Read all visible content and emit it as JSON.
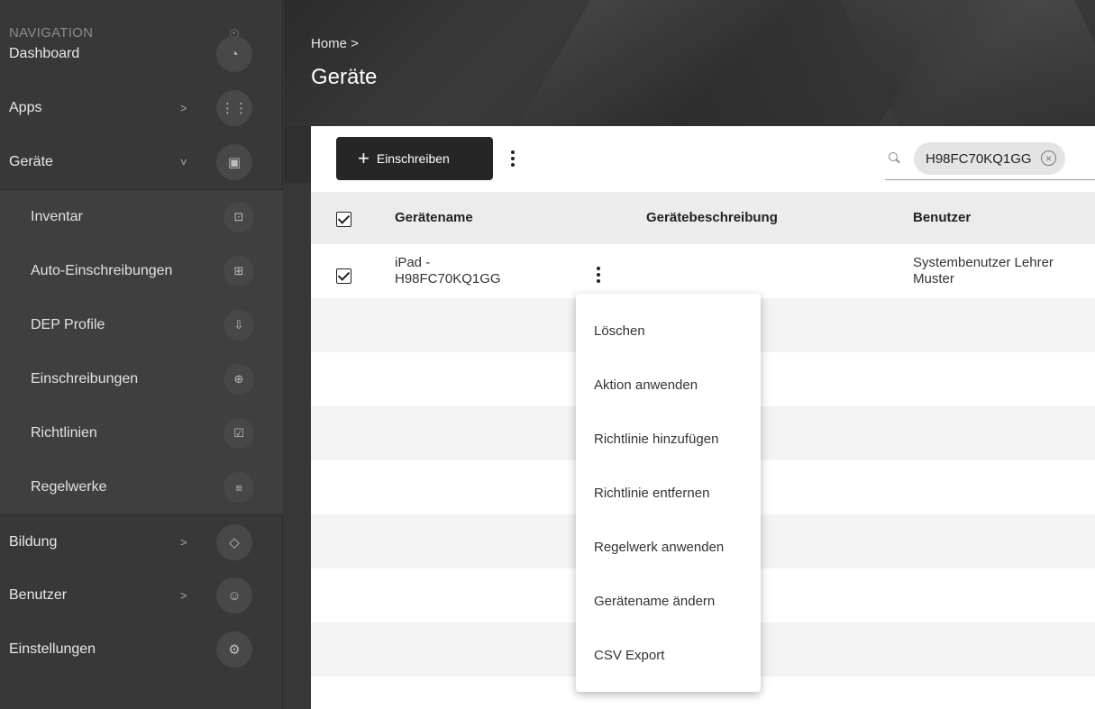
{
  "sidebar": {
    "header": "NAVIGATION",
    "items": [
      {
        "label": "Dashboard",
        "icon": "gauge-icon"
      },
      {
        "label": "Apps",
        "icon": "grid-icon",
        "chevron": ">"
      },
      {
        "label": "Geräte",
        "icon": "devices-icon",
        "chevron": "˅"
      }
    ],
    "subitems": [
      {
        "label": "Inventar",
        "icon": "inventory-icon"
      },
      {
        "label": "Auto-Einschreibungen",
        "icon": "auto-enroll-icon"
      },
      {
        "label": "DEP Profile",
        "icon": "dep-profile-icon"
      },
      {
        "label": "Einschreibungen",
        "icon": "enrollment-icon"
      },
      {
        "label": "Richtlinien",
        "icon": "policy-icon"
      },
      {
        "label": "Regelwerke",
        "icon": "ruleset-icon"
      }
    ],
    "bottom_items": [
      {
        "label": "Bildung",
        "icon": "graduation-cap-icon",
        "chevron": ">"
      },
      {
        "label": "Benutzer",
        "icon": "users-icon",
        "chevron": ">"
      },
      {
        "label": "Einstellungen",
        "icon": "gear-icon"
      }
    ]
  },
  "header": {
    "breadcrumb": "Home >",
    "title": "Geräte"
  },
  "toolbar": {
    "enroll_plus": "+",
    "enroll_label": "Einschreiben",
    "search_value": "H98FC70KQ1GG",
    "search_clear": "×"
  },
  "table": {
    "columns": [
      "Gerätename",
      "Gerätebeschreibung",
      "Benutzer"
    ],
    "rows": [
      {
        "name_line1": "iPad -",
        "name_line2": "H98FC70KQ1GG",
        "description": "",
        "user_line1": "Systembenutzer Lehrer",
        "user_line2": "Muster",
        "checked": true
      }
    ]
  },
  "menu": {
    "items": [
      "Löschen",
      "Aktion anwenden",
      "Richtlinie hinzufügen",
      "Richtlinie entfernen",
      "Regelwerk anwenden",
      "Gerätename ändern",
      "CSV Export"
    ]
  }
}
